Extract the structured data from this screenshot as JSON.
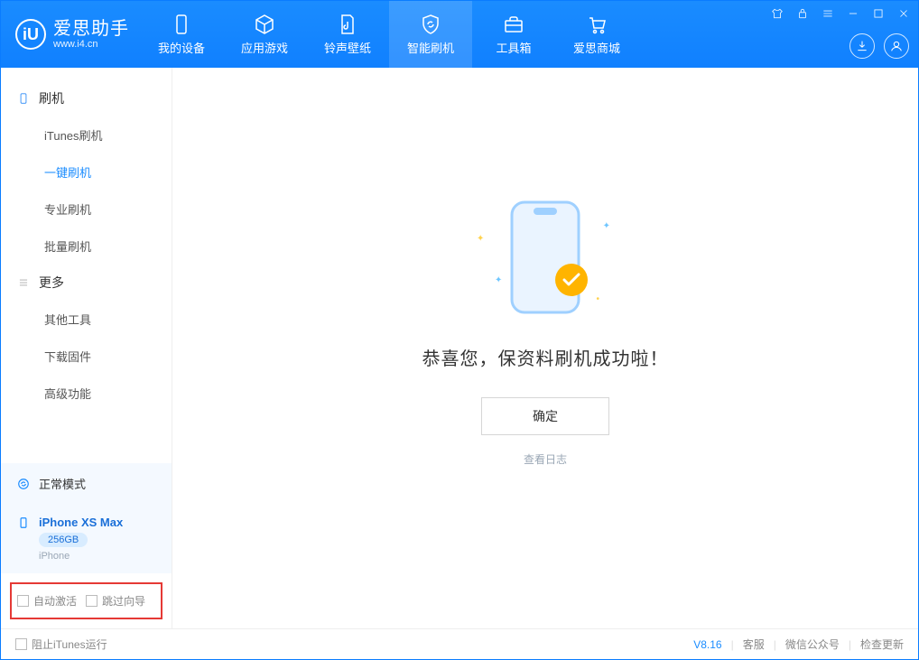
{
  "brand": {
    "title": "爱思助手",
    "subtitle": "www.i4.cn",
    "logo_letter": "iU"
  },
  "tabs": [
    {
      "id": "device",
      "label": "我的设备"
    },
    {
      "id": "apps",
      "label": "应用游戏"
    },
    {
      "id": "ring",
      "label": "铃声壁纸"
    },
    {
      "id": "flash",
      "label": "智能刷机",
      "active": true
    },
    {
      "id": "toolbox",
      "label": "工具箱"
    },
    {
      "id": "store",
      "label": "爱思商城"
    }
  ],
  "sidebar": {
    "section1": {
      "title": "刷机",
      "items": [
        {
          "id": "itunes",
          "label": "iTunes刷机"
        },
        {
          "id": "oneclick",
          "label": "一键刷机",
          "active": true
        },
        {
          "id": "pro",
          "label": "专业刷机"
        },
        {
          "id": "batch",
          "label": "批量刷机"
        }
      ]
    },
    "section2": {
      "title": "更多",
      "items": [
        {
          "id": "other",
          "label": "其他工具"
        },
        {
          "id": "fw",
          "label": "下载固件"
        },
        {
          "id": "adv",
          "label": "高级功能"
        }
      ]
    },
    "mode_label": "正常模式",
    "device": {
      "name": "iPhone XS Max",
      "capacity": "256GB",
      "type": "iPhone"
    },
    "options": {
      "auto_activate": "自动激活",
      "skip_guide": "跳过向导"
    }
  },
  "main": {
    "success_title": "恭喜您，保资料刷机成功啦！",
    "ok_label": "确定",
    "log_link": "查看日志"
  },
  "footer": {
    "block_itunes": "阻止iTunes运行",
    "version": "V8.16",
    "links": {
      "kefu": "客服",
      "wechat": "微信公众号",
      "update": "检查更新"
    }
  }
}
